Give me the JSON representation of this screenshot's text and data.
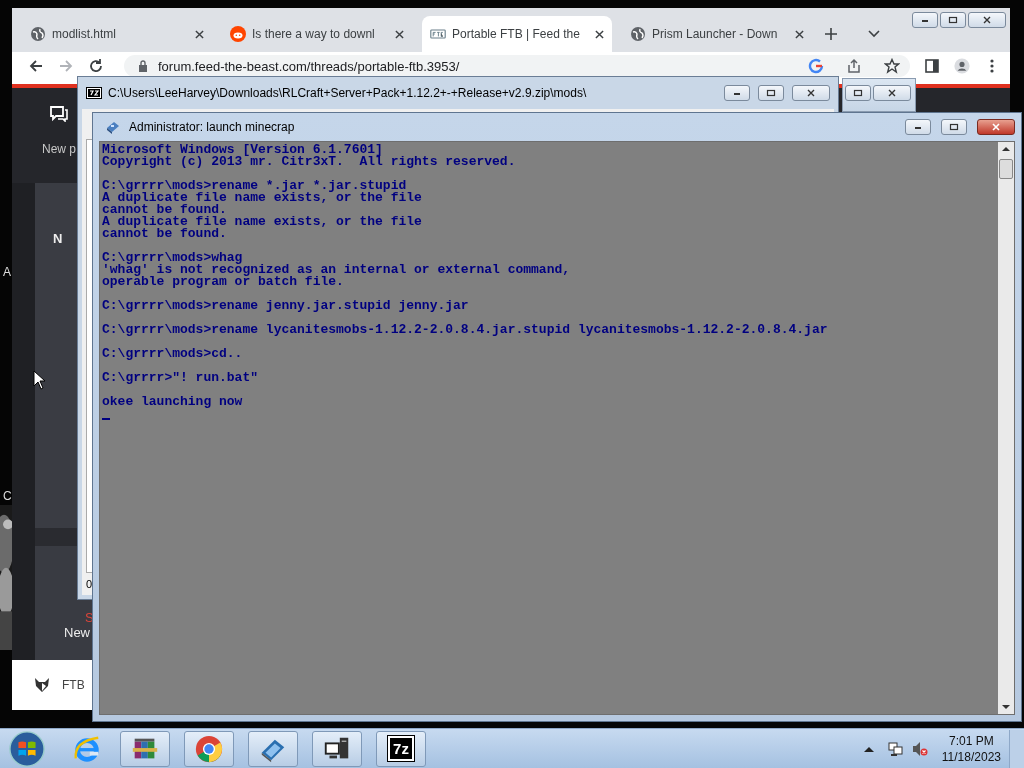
{
  "desktop": {
    "texts": [
      "A",
      "C"
    ]
  },
  "browser": {
    "tabs": [
      {
        "kind": "globe",
        "title": "modlist.html",
        "selected": false
      },
      {
        "kind": "reddit",
        "title": "Is there a way to downl",
        "selected": false
      },
      {
        "kind": "ftb",
        "title": "Portable FTB | Feed the",
        "selected": true
      },
      {
        "kind": "globe",
        "title": "Prism Launcher - Down",
        "selected": false
      }
    ],
    "address": "forum.feed-the-beast.com/threads/portable-ftb.3953/",
    "page": {
      "header_text": "New p",
      "panel_text": "N",
      "accent_text": "S",
      "lower_text": "New",
      "footer_text": "FTB"
    }
  },
  "archive_window": {
    "title": "C:\\Users\\LeeHarvey\\Downloads\\RLCraft+Server+Pack+1.12.2+-+Release+v2.9.zip\\mods\\",
    "status": "0"
  },
  "console_window": {
    "title": "Administrator:  launch minecrap",
    "blocks": [
      [
        "Microsoft Windows [Version 6.1.7601]",
        "Copyright (c) 2013 mr. Citr3xT.  All rights reserved."
      ],
      [
        "C:\\grrrr\\mods>rename *.jar *.jar.stupid",
        "A duplicate file name exists, or the file",
        "cannot be found.",
        "A duplicate file name exists, or the file",
        "cannot be found."
      ],
      [
        "C:\\grrrr\\mods>whag",
        "'whag' is not recognized as an internal or external command,",
        "operable program or batch file."
      ],
      [
        "C:\\grrrr\\mods>rename jenny.jar.stupid jenny.jar"
      ],
      [
        "C:\\grrrr\\mods>rename lycanitesmobs-1.12.2-2.0.8.4.jar.stupid lycanitesmobs-1.12.2-2.0.8.4.jar"
      ],
      [
        "C:\\grrrr\\mods>cd.."
      ],
      [
        "C:\\grrrr>\"! run.bat\""
      ],
      [
        "okee launching now"
      ]
    ]
  },
  "taskbar": {
    "items": [
      {
        "kind": "start"
      },
      {
        "kind": "ie"
      },
      {
        "kind": "archive"
      },
      {
        "kind": "chrome"
      },
      {
        "kind": "app"
      },
      {
        "kind": "network"
      },
      {
        "kind": "sevenzip",
        "label": "7z"
      }
    ],
    "time": "7:01 PM",
    "date": "11/18/2023"
  }
}
